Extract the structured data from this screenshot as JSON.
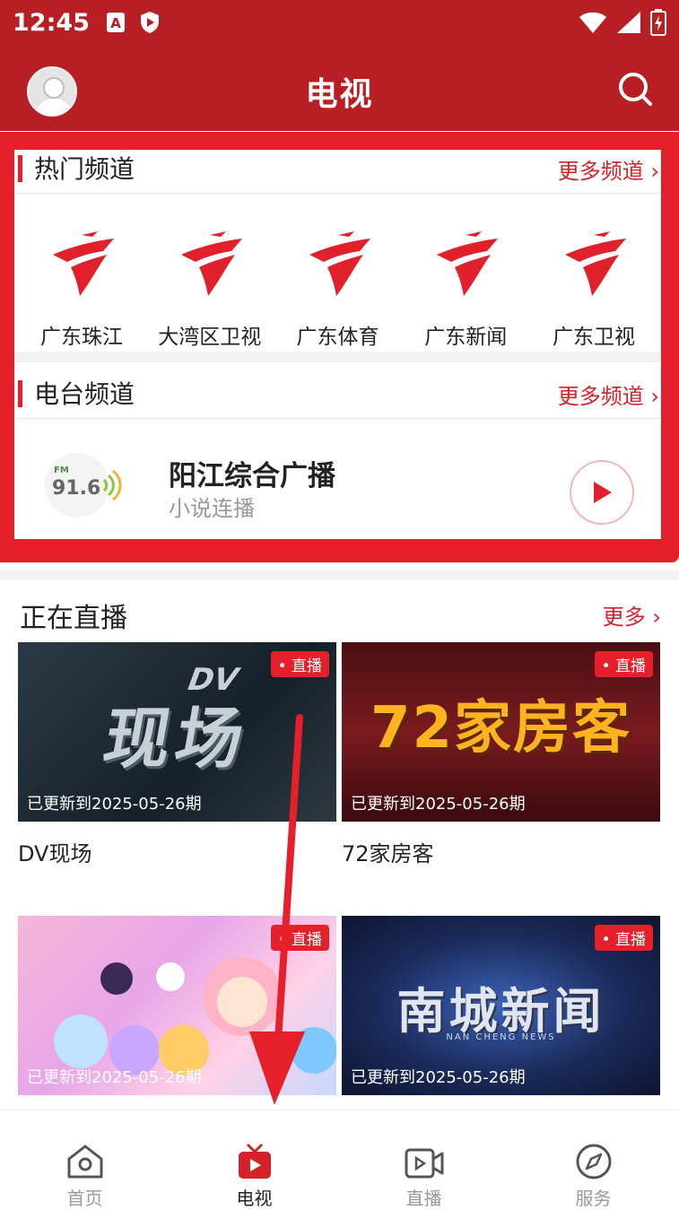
{
  "status": {
    "time": "12:45"
  },
  "header": {
    "title": "电视"
  },
  "hot_channels": {
    "title": "热门频道",
    "more": "更多频道",
    "items": [
      {
        "name": "广东珠江"
      },
      {
        "name": "大湾区卫视"
      },
      {
        "name": "广东体育"
      },
      {
        "name": "广东新闻"
      },
      {
        "name": "广东卫视"
      }
    ]
  },
  "radio_channels": {
    "title": "电台频道",
    "more": "更多频道",
    "station": {
      "name": "阳江综合广播",
      "subtitle": "小说连播",
      "logo_freq": "91.6",
      "logo_fm": "FM"
    }
  },
  "live": {
    "title": "正在直播",
    "more": "更多",
    "badge": "直播",
    "cards": [
      {
        "thumb_text": "现场",
        "thumb_tag": "DV",
        "update": "已更新到2025-05-26期",
        "title": "DV现场"
      },
      {
        "thumb_text": "72家房客",
        "update": "已更新到2025-05-26期",
        "title": "72家房客"
      },
      {
        "update": "已更新到2025-05-26期"
      },
      {
        "thumb_text": "南城新闻",
        "thumb_sub": "NAN CHENG NEWS",
        "update": "已更新到2025-05-26期"
      }
    ]
  },
  "tabbar": {
    "items": [
      {
        "label": "首页",
        "icon": "home-icon"
      },
      {
        "label": "电视",
        "icon": "tv-icon"
      },
      {
        "label": "直播",
        "icon": "video-icon"
      },
      {
        "label": "服务",
        "icon": "compass-icon"
      }
    ],
    "active_color": "#d2232a"
  }
}
